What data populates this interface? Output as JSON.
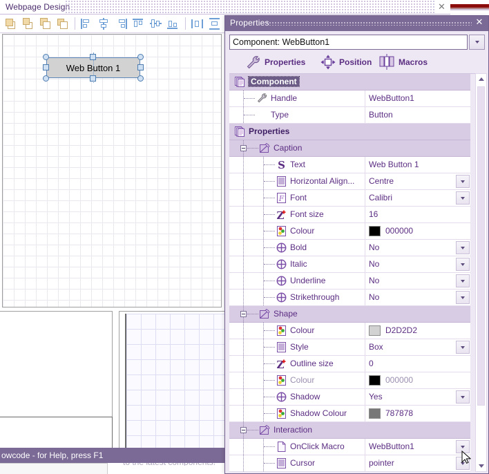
{
  "document_tab": {
    "title": "Webpage Design",
    "close_icon": "close-icon",
    "close_glyph": "✕"
  },
  "status_bar": {
    "text": "owcode - for Help, press F1"
  },
  "background_hint": {
    "text": "to the latest components!"
  },
  "design_canvas": {
    "component": {
      "label": "Web Button 1",
      "fill": "#D2D2D2",
      "border": "#5C85B8"
    }
  },
  "toolbar": {
    "name": "alignment-toolbar",
    "buttons": [
      "bring-to-front",
      "bring-forward",
      "send-backward",
      "send-to-back",
      "align-left",
      "align-centre",
      "align-right",
      "align-top",
      "align-middle",
      "align-bottom",
      "distribute-horizontal",
      "distribute-vertical",
      "make-same-width"
    ]
  },
  "properties_panel": {
    "title": "Properties",
    "close_glyph": "✕",
    "component_selector": {
      "value": "Component: WebButton1",
      "placeholder": "Component:"
    },
    "tabs": [
      {
        "label": "Properties",
        "icon": "wrench-icon"
      },
      {
        "label": "Position",
        "icon": "move-arrows-icon"
      },
      {
        "label": "Macros",
        "icon": "macro-block-icon"
      }
    ],
    "rows": [
      {
        "kind": "category",
        "label": "Component",
        "icon": "pages-icon",
        "selected": true
      },
      {
        "kind": "prop",
        "label": "Handle",
        "value": "WebButton1",
        "icon": "wrench-icon",
        "indent": 1
      },
      {
        "kind": "prop",
        "label": "Type",
        "value": "Button",
        "icon": "none",
        "indent": 1
      },
      {
        "kind": "category",
        "label": "Properties",
        "icon": "pages-icon"
      },
      {
        "kind": "group",
        "label": "Caption",
        "icon": "edit-shape-icon"
      },
      {
        "kind": "prop",
        "label": "Text",
        "value": "Web Button 1",
        "icon": "string-s-icon",
        "indent": 2
      },
      {
        "kind": "prop",
        "label": "Horizontal Align...",
        "value": "Centre",
        "icon": "list-icon",
        "indent": 2,
        "dropdown": true
      },
      {
        "kind": "prop",
        "label": "Font",
        "value": "Calibri",
        "icon": "font-f-icon",
        "indent": 2,
        "dropdown": true
      },
      {
        "kind": "prop",
        "label": "Font size",
        "value": "16",
        "icon": "number-z-icon",
        "indent": 2
      },
      {
        "kind": "prop",
        "label": "Colour",
        "value": "000000",
        "icon": "palette-icon",
        "indent": 2,
        "swatch": "#000000"
      },
      {
        "kind": "prop",
        "label": "Bold",
        "value": "No",
        "icon": "bool-circle-icon",
        "indent": 2,
        "dropdown": true
      },
      {
        "kind": "prop",
        "label": "Italic",
        "value": "No",
        "icon": "bool-circle-icon",
        "indent": 2,
        "dropdown": true
      },
      {
        "kind": "prop",
        "label": "Underline",
        "value": "No",
        "icon": "bool-circle-icon",
        "indent": 2,
        "dropdown": true
      },
      {
        "kind": "prop",
        "label": "Strikethrough",
        "value": "No",
        "icon": "bool-circle-icon",
        "indent": 2,
        "dropdown": true
      },
      {
        "kind": "group",
        "label": "Shape",
        "icon": "edit-shape-icon"
      },
      {
        "kind": "prop",
        "label": "Colour",
        "value": "D2D2D2",
        "icon": "palette-icon",
        "indent": 2,
        "swatch": "#D2D2D2"
      },
      {
        "kind": "prop",
        "label": "Style",
        "value": "Box",
        "icon": "list-icon",
        "indent": 2,
        "dropdown": true
      },
      {
        "kind": "prop",
        "label": "Outline size",
        "value": "0",
        "icon": "number-z-icon",
        "indent": 2
      },
      {
        "kind": "prop",
        "label": "Colour",
        "value": "000000",
        "icon": "palette-icon",
        "indent": 2,
        "swatch": "#000000",
        "disabled": true
      },
      {
        "kind": "prop",
        "label": "Shadow",
        "value": "Yes",
        "icon": "bool-circle-icon",
        "indent": 2,
        "dropdown": true
      },
      {
        "kind": "prop",
        "label": "Shadow Colour",
        "value": "787878",
        "icon": "palette-icon",
        "indent": 2,
        "swatch": "#787878"
      },
      {
        "kind": "group",
        "label": "Interaction",
        "icon": "edit-shape-icon"
      },
      {
        "kind": "prop",
        "label": "OnClick Macro",
        "value": "WebButton1",
        "icon": "page-icon",
        "indent": 2,
        "dropdown": true
      },
      {
        "kind": "prop",
        "label": "Cursor",
        "value": "pointer",
        "icon": "list-icon",
        "indent": 2,
        "dropdown": true
      }
    ]
  },
  "colors": {
    "accent_purple": "#7B6A96",
    "category_row": "#D8CBE4",
    "text_purple": "#5B2D82",
    "selection_blue": "#4D7CB0"
  }
}
